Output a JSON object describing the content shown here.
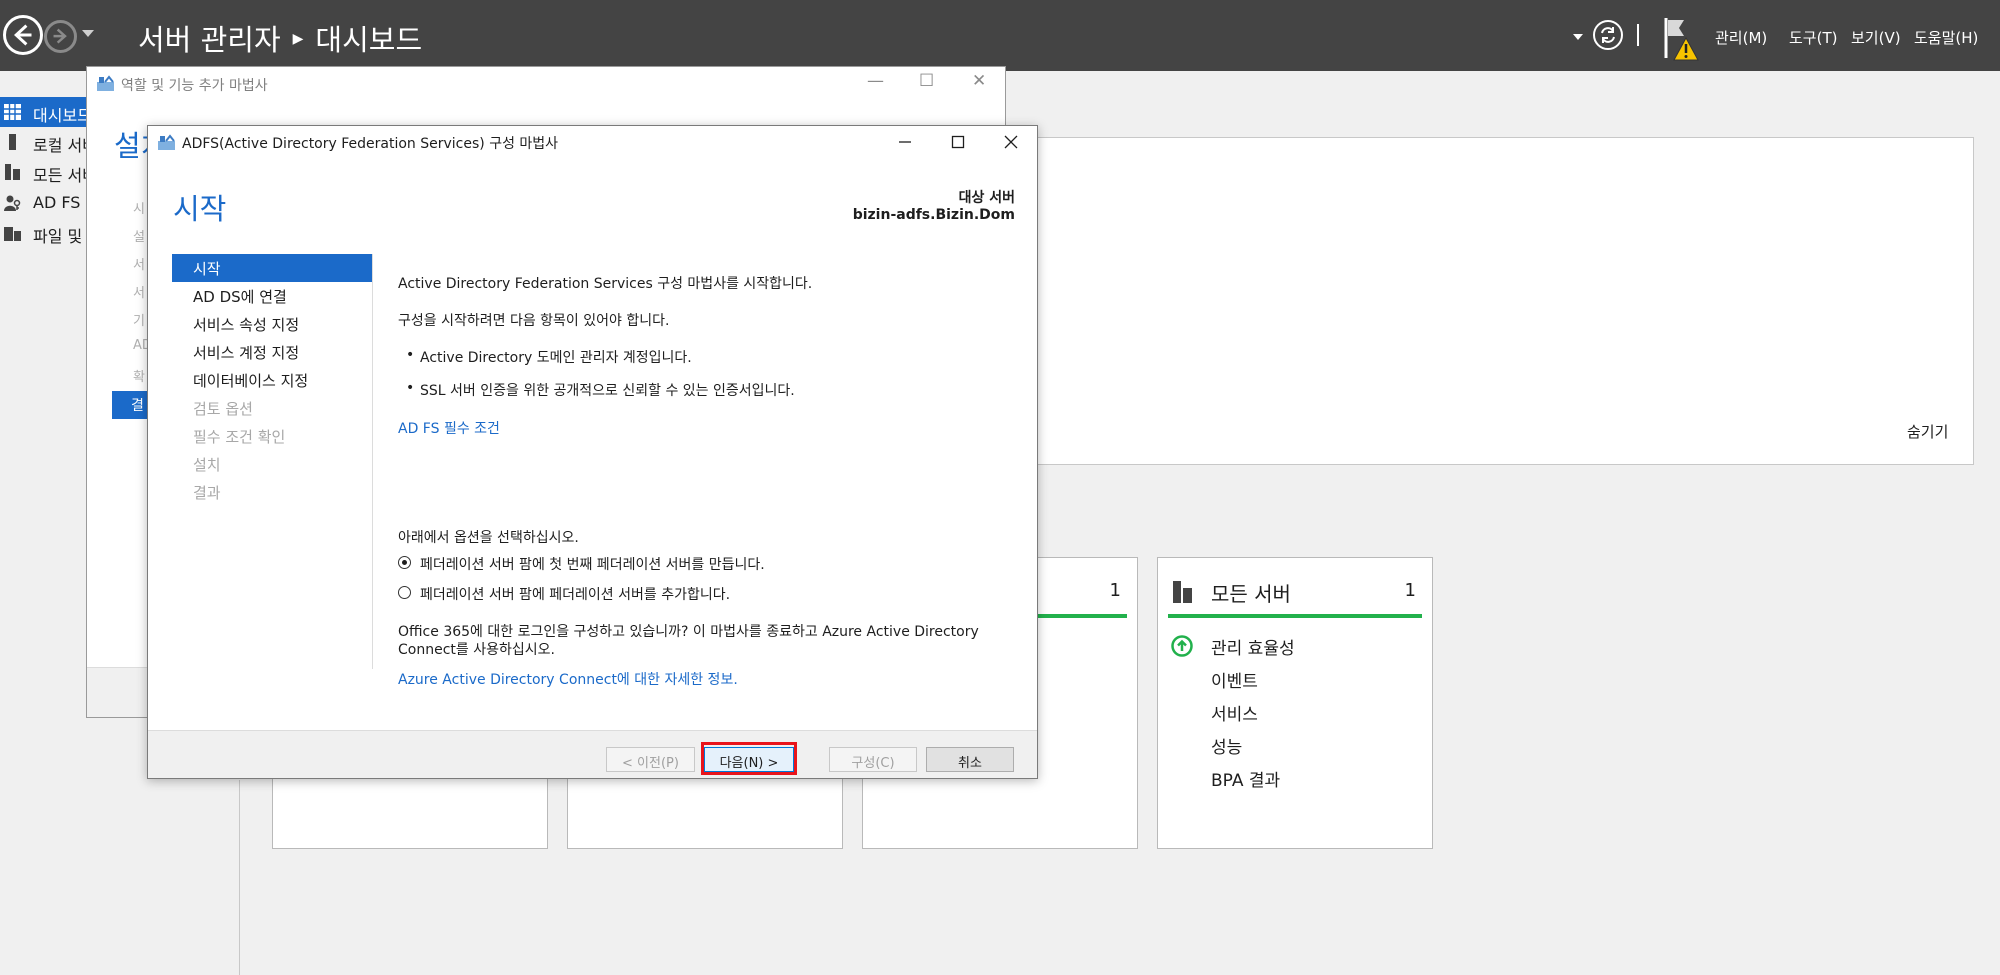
{
  "server_manager": {
    "title_app": "서버 관리자",
    "title_page": "대시보드",
    "menus": [
      "관리(M)",
      "도구(T)",
      "보기(V)",
      "도움말(H)"
    ],
    "sidebar": [
      {
        "label": "대시보드",
        "icon": "dashboard-icon",
        "active": true
      },
      {
        "label": "로컬 서버",
        "icon": "server-icon",
        "active": false
      },
      {
        "label": "모든 서버",
        "icon": "servers-icon",
        "active": false
      },
      {
        "label": "AD FS",
        "icon": "adfs-icon",
        "active": false
      },
      {
        "label": "파일 및 저장소 서비스",
        "icon": "file-storage-icon",
        "active": false
      }
    ],
    "welcome_hide": "숨기기",
    "tile_counts": [
      "1"
    ],
    "all_servers_tile": {
      "title": "모든 서버",
      "count": "1",
      "rows": [
        "관리 효율성",
        "이벤트",
        "서비스",
        "성능",
        "BPA 결과"
      ]
    }
  },
  "bg_wizard": {
    "title": "역할 및 기능 추가 마법사",
    "heading": "설치",
    "steps_partial": [
      "시",
      "설",
      "서",
      "서",
      "기",
      "AD",
      "확"
    ],
    "selected_partial": "결"
  },
  "wizard": {
    "title": "ADFS(Active Directory Federation Services) 구성 마법사",
    "page_title": "시작",
    "target_label": "대상 서버",
    "target_value": "bizin-adfs.Bizin.Dom",
    "steps": [
      {
        "label": "시작",
        "state": "active"
      },
      {
        "label": "AD DS에 연결",
        "state": "enabled"
      },
      {
        "label": "서비스 속성 지정",
        "state": "enabled"
      },
      {
        "label": "서비스 계정 지정",
        "state": "enabled"
      },
      {
        "label": "데이터베이스 지정",
        "state": "enabled"
      },
      {
        "label": "검토 옵션",
        "state": "disabled"
      },
      {
        "label": "필수 조건 확인",
        "state": "disabled"
      },
      {
        "label": "설치",
        "state": "disabled"
      },
      {
        "label": "결과",
        "state": "disabled"
      }
    ],
    "intro": "Active Directory Federation Services 구성 마법사를 시작합니다.",
    "need_text": "구성을 시작하려면 다음 항목이 있어야 합니다.",
    "bullets": [
      "Active Directory 도메인 관리자 계정입니다.",
      "SSL 서버 인증을 위한 공개적으로 신뢰할 수 있는 인증서입니다."
    ],
    "prereq_link": "AD FS 필수 조건",
    "options_label": "아래에서 옵션을 선택하십시오.",
    "options": [
      {
        "label": "페더레이션 서버 팜에 첫 번째 페더레이션 서버를 만듭니다.",
        "checked": true
      },
      {
        "label": "페더레이션 서버 팜에 페더레이션 서버를 추가합니다.",
        "checked": false
      }
    ],
    "office_text": "Office 365에 대한 로그인을 구성하고 있습니까? 이 마법사를 종료하고 Azure Active Directory Connect를 사용하십시오.",
    "azure_link": "Azure Active Directory Connect에 대한 자세한 정보.",
    "buttons": {
      "prev": "< 이전(P)",
      "next": "다음(N) >",
      "configure": "구성(C)",
      "cancel": "취소"
    }
  },
  "colors": {
    "accent": "#1b6ac9",
    "topbar": "#444444",
    "status_green": "#22b14c",
    "highlight_red": "#e8141b"
  }
}
